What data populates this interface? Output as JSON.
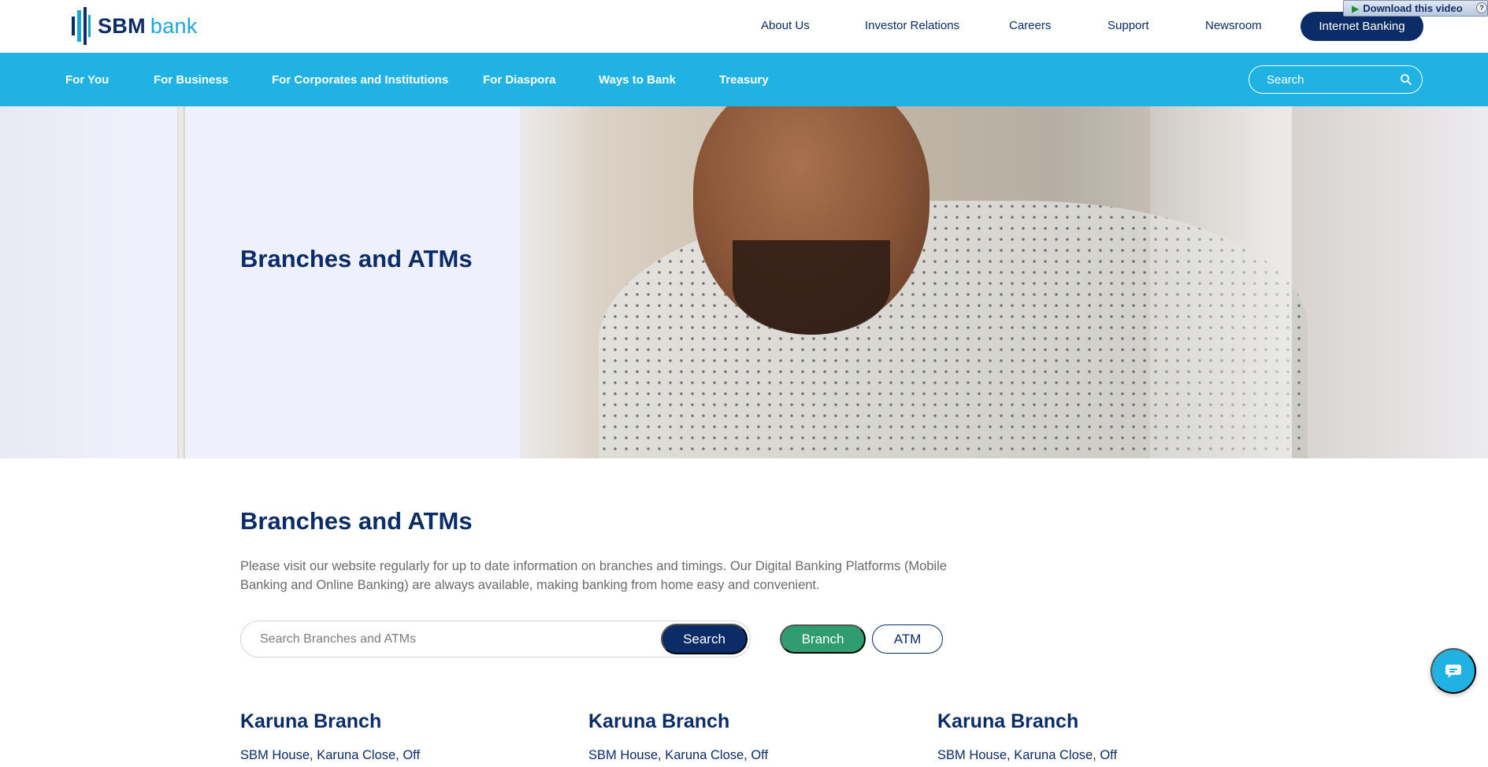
{
  "brand": {
    "name_primary": "SBM",
    "name_secondary": "bank"
  },
  "top_links": [
    "About Us",
    "Investor Relations",
    "Careers",
    "Support",
    "Newsroom"
  ],
  "internet_banking_label": "Internet Banking",
  "download_video": {
    "label": "Download this video",
    "close": "?"
  },
  "nav": {
    "items": [
      "For You",
      "For Business",
      "For Corporates and Institutions",
      "For Diaspora",
      "Ways to Bank",
      "Treasury"
    ],
    "search_placeholder": "Search"
  },
  "hero": {
    "title": "Branches and ATMs"
  },
  "main": {
    "title": "Branches and ATMs",
    "intro": "Please visit our website regularly for up to date information on branches and timings. Our Digital Banking Platforms (Mobile Banking and Online Banking) are always available, making banking from home easy and convenient.",
    "search_placeholder": "Search Branches and ATMs",
    "search_button": "Search",
    "filter_branch": "Branch",
    "filter_atm": "ATM"
  },
  "branches": [
    {
      "name": "Karuna Branch",
      "address": "SBM House, Karuna Close, Off"
    },
    {
      "name": "Karuna Branch",
      "address": "SBM House, Karuna Close, Off"
    },
    {
      "name": "Karuna Branch",
      "address": "SBM House, Karuna Close, Off"
    }
  ],
  "colors": {
    "navy": "#0b2c66",
    "sky": "#1fb2e3",
    "green": "#2f9d6f"
  },
  "icons": {
    "search": "search-icon",
    "chat": "chat-icon",
    "logo": "sbm-logo-icon"
  }
}
